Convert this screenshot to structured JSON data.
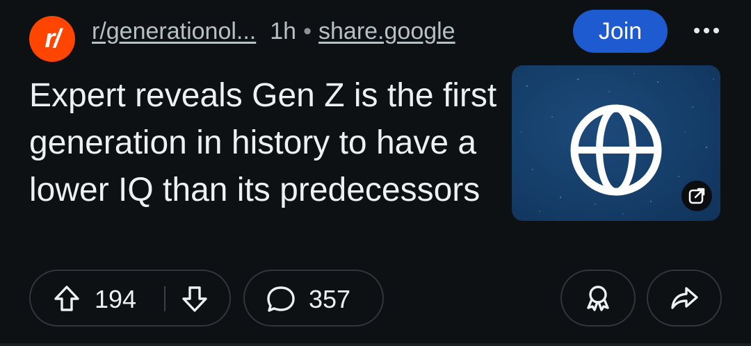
{
  "post": {
    "subreddit": {
      "avatar_text": "r/",
      "name": "r/generationol...",
      "avatar_color": "#ff4500"
    },
    "age": "1h",
    "separator": "•",
    "domain": "share.google",
    "join_label": "Join",
    "title": "Expert reveals Gen Z is the first generation in history to have a lower IQ than its predecessors",
    "thumbnail": {
      "icon": "globe-icon",
      "badge_icon": "external-link-icon",
      "color": "#16406c"
    },
    "actions": {
      "upvotes": "194",
      "comments": "357",
      "upvote_icon": "arrow-up-icon",
      "downvote_icon": "arrow-down-icon",
      "comment_icon": "comment-bubble-icon",
      "award_icon": "award-icon",
      "share_icon": "share-icon"
    }
  },
  "theme": {
    "background": "#0e1113",
    "join_button": "#1f5bd0",
    "pill_border": "#2f373c"
  }
}
